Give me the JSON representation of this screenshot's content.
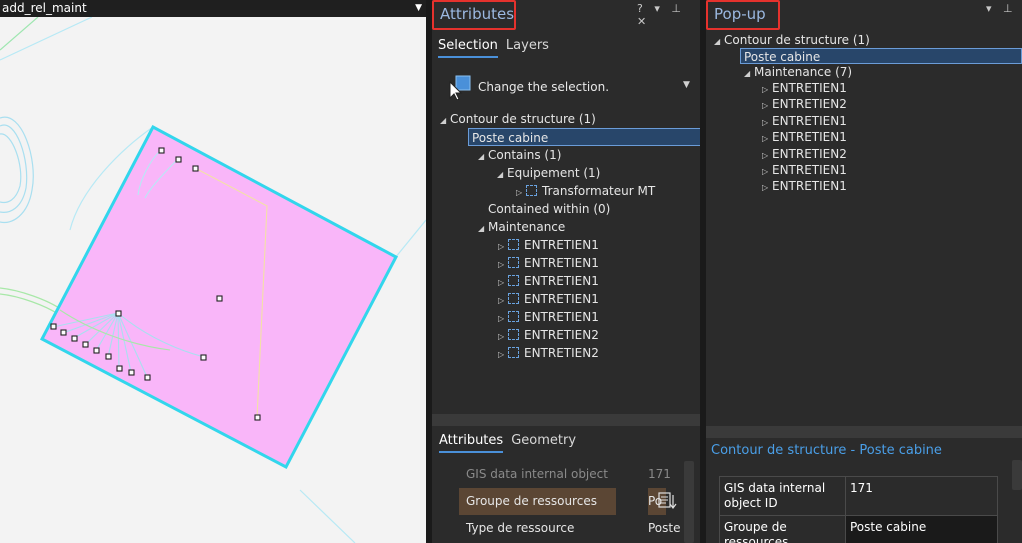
{
  "map": {
    "tab_title": "add_rel_maint",
    "colors": {
      "polygon_fill": "#f9b6f9",
      "polygon_outline": "#32d6ec",
      "background": "#f3f3f3"
    }
  },
  "attributes_panel": {
    "title": "Attributes",
    "controls": {
      "help": "?",
      "menu": "▾",
      "pin": "📌",
      "close": "✕"
    },
    "tabs": [
      {
        "label": "Selection",
        "active": true
      },
      {
        "label": "Layers",
        "active": false
      }
    ],
    "change_selection": {
      "label": "Change the selection.",
      "icon": "select-cursor-icon"
    },
    "tree": [
      {
        "label": "Contour de structure  (1)",
        "toggle": "◢",
        "feature_icon": false,
        "selected": false
      },
      {
        "label": "Poste cabine",
        "toggle": "◢",
        "feature_icon": false,
        "selected": true
      },
      {
        "label": "Contains  (1)",
        "toggle": "◢",
        "feature_icon": false,
        "selected": false
      },
      {
        "label": "Equipement  (1)",
        "toggle": "◢",
        "feature_icon": false,
        "selected": false
      },
      {
        "label": "Transformateur MT",
        "toggle": "▷",
        "feature_icon": true,
        "selected": false
      },
      {
        "label": "Contained within  (0)",
        "toggle": "",
        "feature_icon": false,
        "selected": false
      },
      {
        "label": "Maintenance",
        "toggle": "◢",
        "feature_icon": false,
        "selected": false
      },
      {
        "label": "ENTRETIEN1",
        "toggle": "▷",
        "feature_icon": true,
        "selected": false
      },
      {
        "label": "ENTRETIEN1",
        "toggle": "▷",
        "feature_icon": true,
        "selected": false
      },
      {
        "label": "ENTRETIEN1",
        "toggle": "▷",
        "feature_icon": true,
        "selected": false
      },
      {
        "label": "ENTRETIEN1",
        "toggle": "▷",
        "feature_icon": true,
        "selected": false
      },
      {
        "label": "ENTRETIEN1",
        "toggle": "▷",
        "feature_icon": true,
        "selected": false
      },
      {
        "label": "ENTRETIEN2",
        "toggle": "▷",
        "feature_icon": true,
        "selected": false
      },
      {
        "label": "ENTRETIEN2",
        "toggle": "▷",
        "feature_icon": true,
        "selected": false
      }
    ],
    "bottom_tabs": [
      {
        "label": "Attributes",
        "active": true
      },
      {
        "label": "Geometry",
        "active": false
      }
    ],
    "attributes": [
      {
        "field": "GIS data internal object ID",
        "value": "171",
        "dim": true,
        "highlight": false
      },
      {
        "field": "Groupe de ressources",
        "value": "Po",
        "dim": false,
        "highlight": true
      },
      {
        "field": "Type de ressource",
        "value": "Poste",
        "dim": false,
        "highlight": false
      }
    ]
  },
  "popup_panel": {
    "title": "Pop-up",
    "controls": {
      "menu": "▾",
      "pin": "📌",
      "close": "✕"
    },
    "tree": [
      {
        "label": "Contour de structure  (1)",
        "toggle": "◢",
        "selected": false
      },
      {
        "label": "Poste cabine",
        "toggle": "◢",
        "selected": true
      },
      {
        "label": "Maintenance  (7)",
        "toggle": "◢",
        "selected": false
      },
      {
        "label": "ENTRETIEN1",
        "toggle": "▷",
        "selected": false
      },
      {
        "label": "ENTRETIEN2",
        "toggle": "▷",
        "selected": false
      },
      {
        "label": "ENTRETIEN1",
        "toggle": "▷",
        "selected": false
      },
      {
        "label": "ENTRETIEN1",
        "toggle": "▷",
        "selected": false
      },
      {
        "label": "ENTRETIEN2",
        "toggle": "▷",
        "selected": false
      },
      {
        "label": "ENTRETIEN1",
        "toggle": "▷",
        "selected": false
      },
      {
        "label": "ENTRETIEN1",
        "toggle": "▷",
        "selected": false
      }
    ],
    "section_title": "Contour de structure - Poste cabine",
    "fields": [
      {
        "field": "GIS data internal object ID",
        "value": "171"
      },
      {
        "field": "Groupe de ressources",
        "value": "Poste cabine"
      }
    ]
  }
}
